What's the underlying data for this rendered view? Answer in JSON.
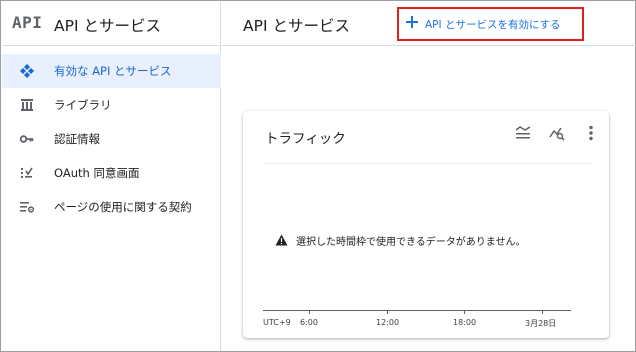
{
  "sidebar": {
    "logo_text": "API",
    "title": "API とサービス",
    "items": [
      {
        "label": "有効な API とサービス",
        "icon": "api-diamond-icon",
        "active": true
      },
      {
        "label": "ライブラリ",
        "icon": "library-icon",
        "active": false
      },
      {
        "label": "認証情報",
        "icon": "key-icon",
        "active": false
      },
      {
        "label": "OAuth 同意画面",
        "icon": "oauth-consent-icon",
        "active": false
      },
      {
        "label": "ページの使用に関する契約",
        "icon": "settings-list-icon",
        "active": false
      }
    ]
  },
  "header": {
    "title": "API とサービス",
    "enable_button_label": "API とサービスを有効にする"
  },
  "traffic_card": {
    "title": "トラフィック",
    "empty_message": "選択した時間枠で使用できるデータがありません。",
    "timezone_label": "UTC+9",
    "x_ticks": [
      "6:00",
      "12:00",
      "18:00",
      "3月28日"
    ]
  },
  "colors": {
    "accent": "#1a73e8",
    "active_bg": "#e8f0fe",
    "highlight_border": "#e0201b"
  }
}
